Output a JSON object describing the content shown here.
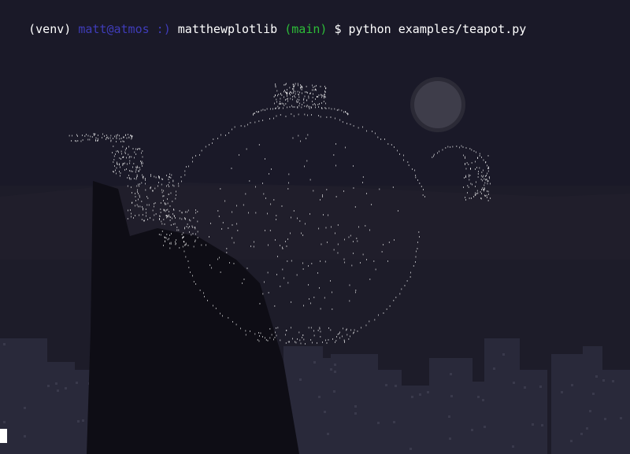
{
  "colors": {
    "background": "#15141f",
    "sky": "#1a1928",
    "water": "#1d1c29",
    "hills": "#22212e",
    "buildings": "#29293a",
    "building_windows": "#3a3a4c",
    "silhouette": "#0e0d15",
    "moon": "#3e3d4a",
    "moon_ring": "#2b2a36",
    "prompt_text": "#ffffff",
    "user_host": "#3f3cb9",
    "branch": "#2dbd38",
    "ascii_art": "#ffffff",
    "cursor": "#ffffff"
  },
  "prompt": {
    "venv": "(venv) ",
    "user_host": "matt@atmos :) ",
    "cwd": "matthewplotlib ",
    "branch": "(main)",
    "symbol": " $ ",
    "command": "python examples/teapot.py"
  },
  "render": {
    "glyph": "'",
    "description_icon": "teapot-ascii-art"
  }
}
